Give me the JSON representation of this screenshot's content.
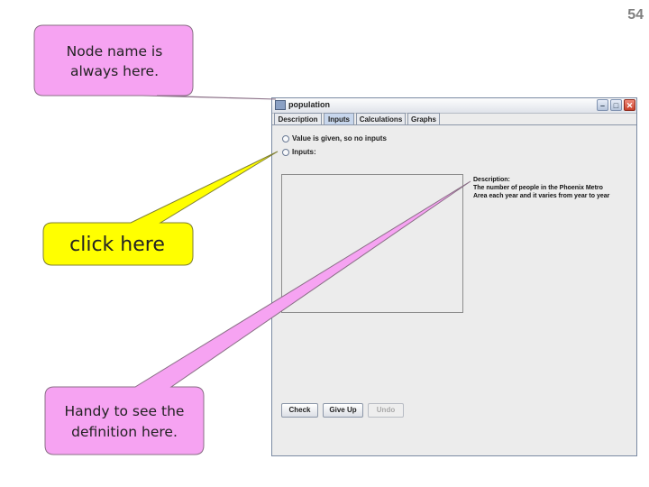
{
  "slide": {
    "number": "54"
  },
  "callouts": {
    "node_name": "Node name is always here.",
    "click_here": "click here",
    "definition": "Handy to see the definition here."
  },
  "window": {
    "title": "population",
    "tabs": [
      {
        "label": "Description",
        "active": false
      },
      {
        "label": "Inputs",
        "active": true
      },
      {
        "label": "Calculations",
        "active": false
      },
      {
        "label": "Graphs",
        "active": false
      }
    ],
    "options": {
      "value_given": "Value is given, so no inputs",
      "inputs": "Inputs:"
    },
    "description": {
      "heading": "Description:",
      "line1": "The number of people in the Phoenix Metro",
      "line2": "Area each year and it varies from year to year"
    },
    "buttons": {
      "check": "Check",
      "give_up": "Give Up",
      "undo": "Undo"
    }
  },
  "colors": {
    "pink_callout": "#f6a3f2",
    "yellow_callout": "#ffff00",
    "accent_tab": "#c7d6ec"
  }
}
